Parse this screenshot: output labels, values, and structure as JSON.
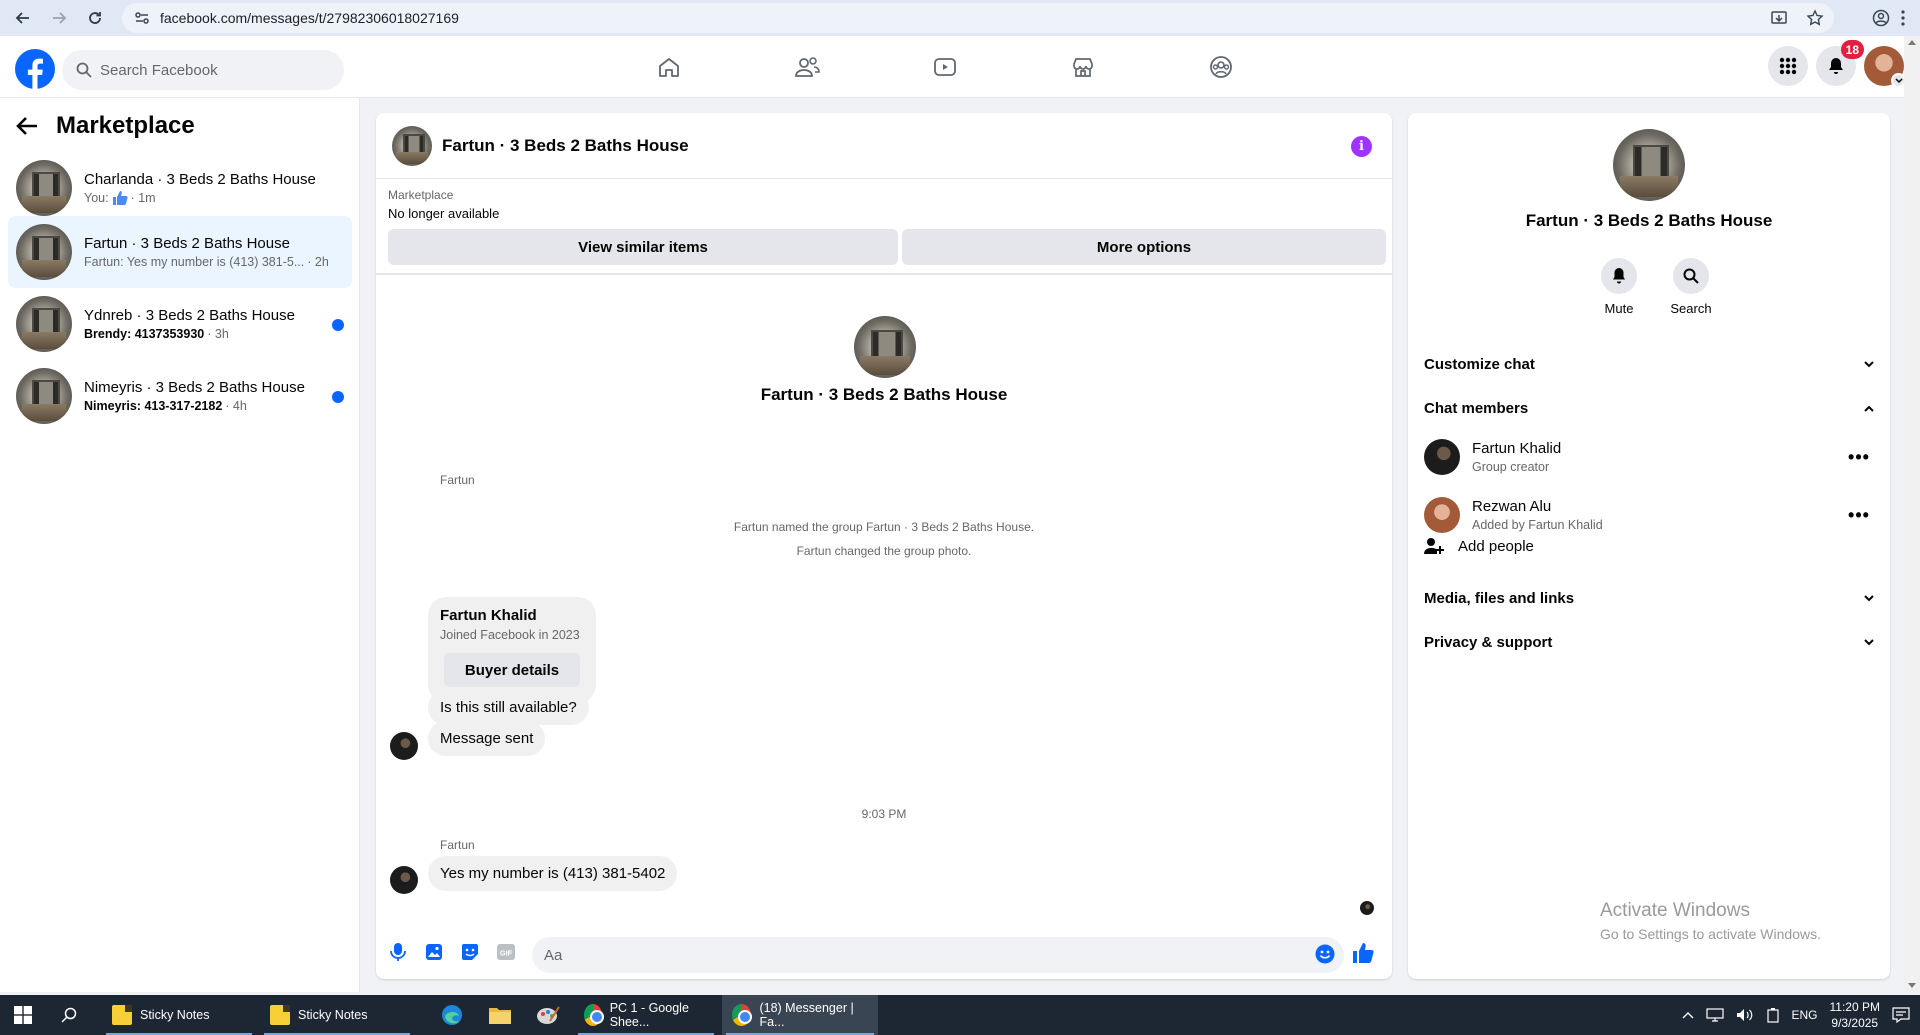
{
  "browser": {
    "url": "facebook.com/messages/t/27982306018027169"
  },
  "fb_header": {
    "search_placeholder": "Search Facebook",
    "notification_count": "18"
  },
  "sidebar": {
    "title": "Marketplace",
    "conversations": [
      {
        "title": "Charlanda · 3 Beds 2 Baths House",
        "preview_prefix": "You:",
        "preview": "",
        "time": "· 1m",
        "unread": false,
        "active": false
      },
      {
        "title": "Fartun · 3 Beds 2 Baths House",
        "preview": "Fartun: Yes my number is (413) 381-5...",
        "time": "· 2h",
        "unread": false,
        "active": true
      },
      {
        "title": "Ydnreb · 3 Beds 2 Baths House",
        "preview": "Brendy: 4137353930",
        "time": "· 3h",
        "unread": true,
        "active": false
      },
      {
        "title": "Nimeyris · 3 Beds 2 Baths House",
        "preview": "Nimeyris: 413-317-2182",
        "time": "· 4h",
        "unread": true,
        "active": false
      }
    ]
  },
  "chat": {
    "title": "Fartun · 3 Beds 2 Baths House",
    "marketplace_label": "Marketplace",
    "listing_status": "No longer available",
    "view_similar_label": "View similar items",
    "more_options_label": "More options",
    "group_name": "Fartun · 3 Beds 2 Baths House",
    "system_messages": [
      "Fartun named the group Fartun · 3 Beds 2 Baths House.",
      "Fartun changed the group photo."
    ],
    "sender_1": "Fartun",
    "card": {
      "name": "Fartun Khalid",
      "subtitle": "Joined Facebook in 2023",
      "button": "Buyer details"
    },
    "msg_available": "Is this still available?",
    "msg_sent": "Message sent",
    "timestamp": "9:03 PM",
    "sender_2": "Fartun",
    "msg_number": "Yes my number is (413) 381-5402",
    "input_placeholder": "Aa"
  },
  "details": {
    "name": "Fartun · 3 Beds 2 Baths House",
    "mute_label": "Mute",
    "search_label": "Search",
    "customize_chat": "Customize chat",
    "chat_members": "Chat members",
    "members": [
      {
        "name": "Fartun Khalid",
        "sub": "Group creator"
      },
      {
        "name": "Rezwan Alu",
        "sub": "Added by Fartun Khalid"
      }
    ],
    "add_people": "Add people",
    "media_files_links": "Media, files and links",
    "privacy_support": "Privacy & support"
  },
  "watermark": {
    "line1": "Activate Windows",
    "line2": "Go to Settings to activate Windows."
  },
  "taskbar": {
    "items": [
      {
        "label": "Sticky Notes"
      },
      {
        "label": "Sticky Notes"
      },
      {
        "label": "PC 1 - Google Shee..."
      },
      {
        "label": "(18) Messenger | Fa..."
      }
    ],
    "language": "ENG",
    "time": "11:20 PM",
    "date": "9/3/2025"
  },
  "colors": {
    "fb_blue": "#0866ff",
    "active_conversation_bg": "#ebf5ff",
    "info_purple": "#a033ff",
    "notification_red": "#e41e3f"
  },
  "icons": [
    "back-icon",
    "forward-icon",
    "reload-icon",
    "site-settings-icon",
    "install-icon",
    "star-icon",
    "profile-icon",
    "kebab-icon",
    "facebook-logo",
    "search-icon",
    "home-icon",
    "friends-icon",
    "watch-icon",
    "marketplace-icon",
    "groups-icon",
    "menu-grid-icon",
    "bell-icon",
    "mic-icon",
    "image-icon",
    "sticker-icon",
    "gif-icon",
    "emoji-icon",
    "thumbs-up-icon",
    "add-person-icon",
    "chevron-down-icon",
    "chevron-up-icon",
    "more-icon"
  ]
}
